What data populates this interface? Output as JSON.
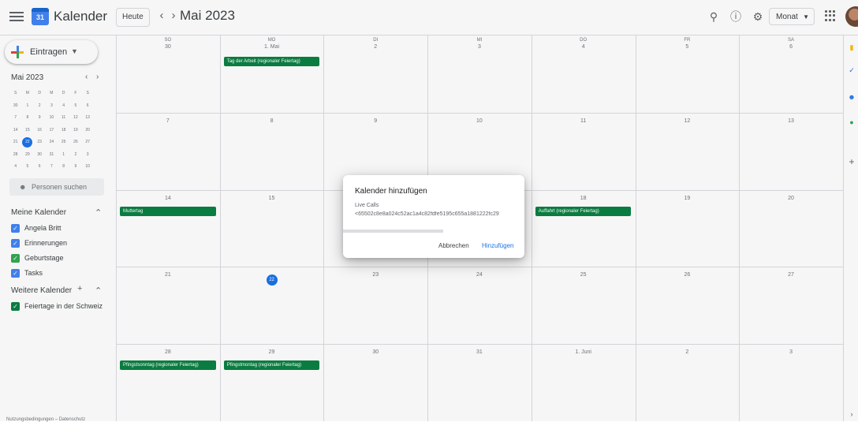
{
  "header": {
    "app_title": "Kalender",
    "today_label": "Heute",
    "prev_label": "‹",
    "next_label": "›",
    "month_title": "Mai 2023",
    "view_label": "Monat",
    "logo_text": "31"
  },
  "sidebar": {
    "create_label": "Eintragen",
    "mini_title": "Mai 2023",
    "mini_weekdays": [
      "S",
      "M",
      "D",
      "M",
      "D",
      "F",
      "S"
    ],
    "mini_rows": [
      [
        "30",
        "1",
        "2",
        "3",
        "4",
        "5",
        "6"
      ],
      [
        "7",
        "8",
        "9",
        "10",
        "11",
        "12",
        "13"
      ],
      [
        "14",
        "15",
        "16",
        "17",
        "18",
        "19",
        "20"
      ],
      [
        "21",
        "22",
        "23",
        "24",
        "25",
        "26",
        "27"
      ],
      [
        "28",
        "29",
        "30",
        "31",
        "1",
        "2",
        "3"
      ],
      [
        "4",
        "5",
        "6",
        "7",
        "8",
        "9",
        "10"
      ]
    ],
    "mini_today": "22",
    "people_search": "Personen suchen",
    "my_calendars_title": "Meine Kalender",
    "my_calendars": [
      {
        "name": "Angela Britt",
        "color": "#4285f4"
      },
      {
        "name": "Erinnerungen",
        "color": "#4285f4"
      },
      {
        "name": "Geburtstage",
        "color": "#34a853"
      },
      {
        "name": "Tasks",
        "color": "#4285f4"
      }
    ],
    "other_calendars_title": "Weitere Kalender",
    "other_calendars": [
      {
        "name": "Feiertage in der Schweiz",
        "color": "#0b8043"
      }
    ],
    "footer": "Nutzungsbedingungen – Datenschutz"
  },
  "calendar": {
    "weekdays": [
      "SO",
      "MO",
      "DI",
      "MI",
      "DO",
      "FR",
      "SA"
    ],
    "weeks": [
      [
        "30",
        "1. Mai",
        "2",
        "3",
        "4",
        "5",
        "6"
      ],
      [
        "7",
        "8",
        "9",
        "10",
        "11",
        "12",
        "13"
      ],
      [
        "14",
        "15",
        "16",
        "17",
        "18",
        "19",
        "20"
      ],
      [
        "21",
        "22",
        "23",
        "24",
        "25",
        "26",
        "27"
      ],
      [
        "28",
        "29",
        "30",
        "31",
        "1. Juni",
        "2",
        "3"
      ]
    ],
    "today": "22",
    "event_color": "#0b8043",
    "events": [
      {
        "week": 0,
        "day": 1,
        "title": "Tag der Arbeit (regionaler Feiertag)"
      },
      {
        "week": 2,
        "day": 0,
        "title": "Muttertag"
      },
      {
        "week": 2,
        "day": 4,
        "title": "Auffahrt (regionaler Feiertag)"
      },
      {
        "week": 4,
        "day": 0,
        "title": "Pfingstsonntag (regionaler Feiertag)"
      },
      {
        "week": 4,
        "day": 1,
        "title": "Pfingstmontag (regionaler Feiertag)"
      }
    ]
  },
  "dialog": {
    "title": "Kalender hinzufügen",
    "calendar_name": "Live Calls",
    "calendar_url": "<65502c8e8a024c52ac1a4c82fdfe5195c655a1881222fc29",
    "cancel_label": "Abbrechen",
    "add_label": "Hinzufügen",
    "progress_percent": 100
  }
}
